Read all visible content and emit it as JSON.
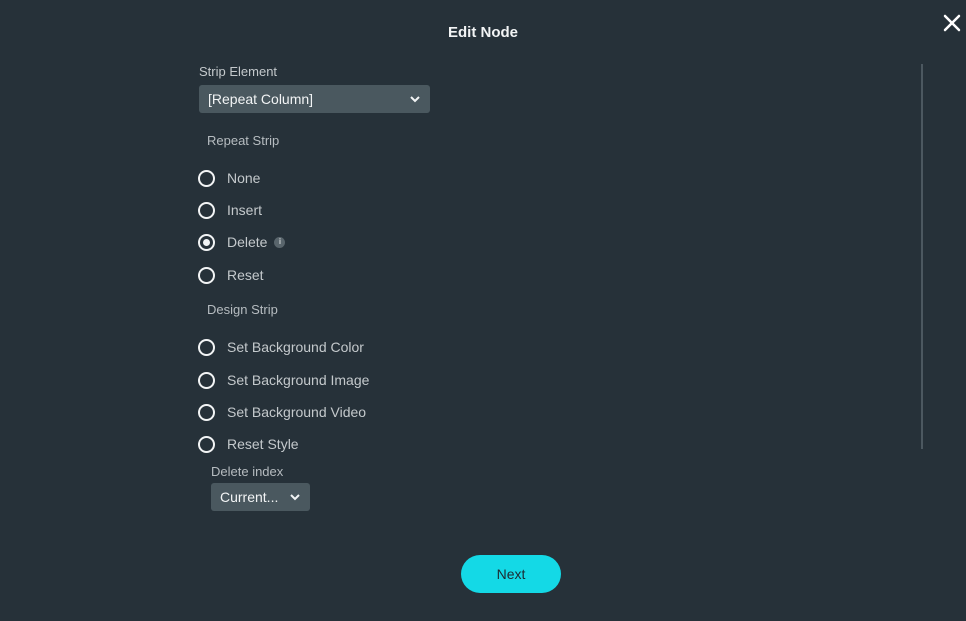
{
  "dialog": {
    "title": "Edit Node",
    "close_icon": "close-icon"
  },
  "strip_element": {
    "label": "Strip Element",
    "selected": "[Repeat Column]",
    "chevron_icon": "chevron-down-icon"
  },
  "repeat_strip": {
    "heading": "Repeat Strip",
    "options": [
      {
        "label": "None",
        "checked": false
      },
      {
        "label": "Insert",
        "checked": false
      },
      {
        "label": "Delete",
        "checked": true,
        "info_icon": "info-icon",
        "info_glyph": "i"
      },
      {
        "label": "Reset",
        "checked": false
      }
    ]
  },
  "design_strip": {
    "heading": "Design Strip",
    "options": [
      {
        "label": "Set Background Color",
        "checked": false
      },
      {
        "label": "Set Background Image",
        "checked": false
      },
      {
        "label": "Set Background Video",
        "checked": false
      },
      {
        "label": "Reset Style",
        "checked": false
      }
    ]
  },
  "delete_index": {
    "label": "Delete index",
    "selected": "Current...",
    "chevron_icon": "chevron-down-icon"
  },
  "footer": {
    "next_label": "Next"
  },
  "colors": {
    "background": "#263139",
    "select_bg": "#4a585f",
    "accent": "#14d9e6"
  }
}
